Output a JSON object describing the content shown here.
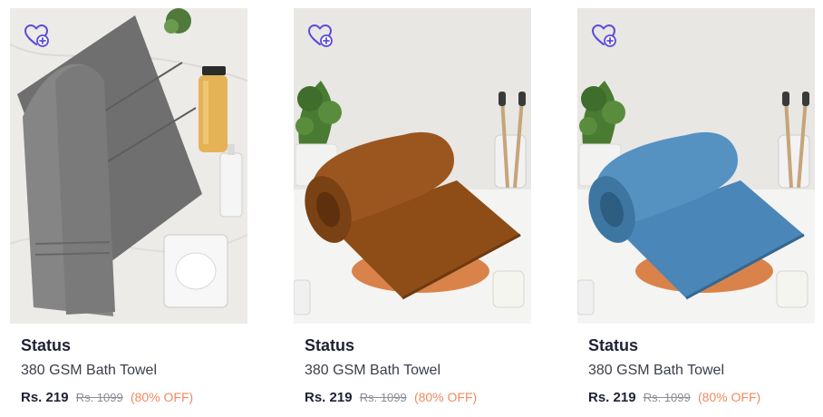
{
  "products": [
    {
      "brand": "Status",
      "name": "380 GSM Bath Towel",
      "price": "Rs. 219",
      "mrp": "Rs. 1099",
      "discount": "(80% OFF)",
      "towel_color": "#7c7c7c",
      "wishlist_icon": "heart-plus-icon"
    },
    {
      "brand": "Status",
      "name": "380 GSM Bath Towel",
      "price": "Rs. 219",
      "mrp": "Rs. 1099",
      "discount": "(80% OFF)",
      "towel_color": "#8b4a16",
      "wishlist_icon": "heart-plus-icon"
    },
    {
      "brand": "Status",
      "name": "380 GSM Bath Towel",
      "price": "Rs. 219",
      "mrp": "Rs. 1099",
      "discount": "(80% OFF)",
      "towel_color": "#4b86b6",
      "wishlist_icon": "heart-plus-icon"
    }
  ],
  "colors": {
    "accent": "#5b4bd8",
    "discount": "#f0895f",
    "text_primary": "#1f2234"
  }
}
